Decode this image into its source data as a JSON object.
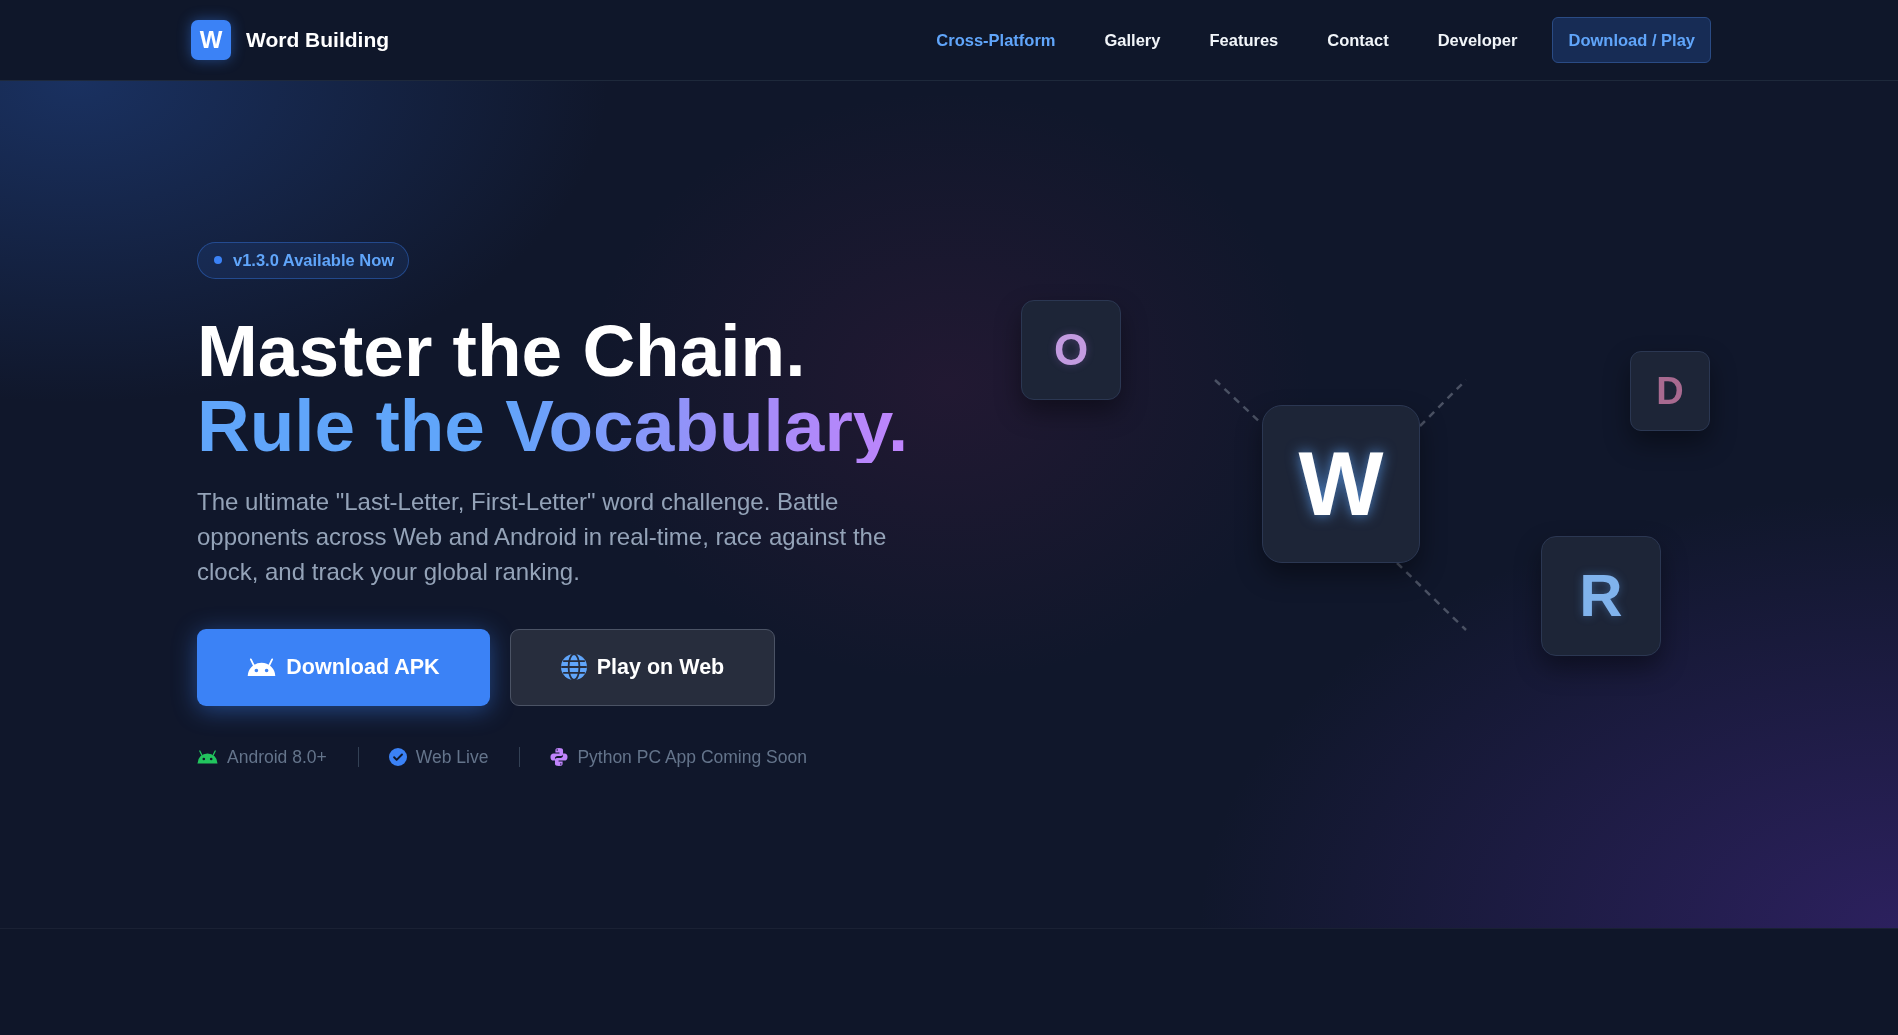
{
  "nav": {
    "logo": {
      "letter": "W",
      "name": "Word Building"
    },
    "links": [
      {
        "label": "Cross-Platform",
        "selected": true
      },
      {
        "label": "Gallery",
        "selected": false
      },
      {
        "label": "Features",
        "selected": false
      },
      {
        "label": "Contact",
        "selected": false
      },
      {
        "label": "Developer",
        "selected": false
      }
    ],
    "cta": "Download / Play"
  },
  "hero": {
    "badge": "v1.3.0 Available Now",
    "headline": "Master the Chain.",
    "headline_accent": "Rule the Vocabulary.",
    "description": "The ultimate \"Last-Letter, First-Letter\" word challenge. Battle opponents across Web and Android in real-time, race against the clock, and track your global ranking.",
    "buttons": [
      {
        "label": "Download APK",
        "kind": "primary"
      },
      {
        "label": "Play on Web",
        "kind": "secondary"
      }
    ],
    "platforms": [
      {
        "label": "Android 8.0+"
      },
      {
        "label": "Web Live"
      },
      {
        "label": "Python PC App Coming Soon"
      }
    ],
    "tiles": [
      {
        "letter": "O",
        "color": "#c39be0"
      },
      {
        "letter": "W",
        "color": "#ffffff"
      },
      {
        "letter": "D",
        "color": "#a86a90"
      },
      {
        "letter": "R",
        "color": "#80b3ec"
      }
    ]
  }
}
